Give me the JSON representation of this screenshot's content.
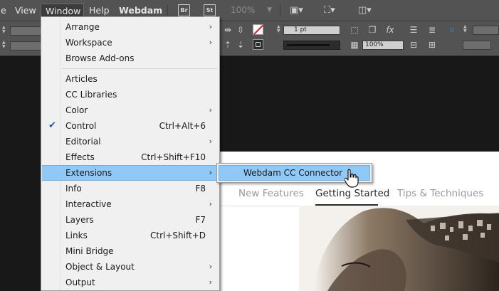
{
  "menubar": {
    "partial_item": "e",
    "items": [
      "View",
      "Window",
      "Help",
      "Webdam"
    ],
    "bridge_label": "Br",
    "stock_label": "St",
    "zoom": "100%"
  },
  "control": {
    "stroke_weight": "1 pt",
    "opacity": "100%"
  },
  "window_menu": {
    "items": [
      {
        "label": "Arrange",
        "submenu": true
      },
      {
        "label": "Workspace",
        "submenu": true
      },
      {
        "label": "Browse Add-ons"
      },
      {
        "label": "Articles"
      },
      {
        "label": "CC Libraries"
      },
      {
        "label": "Color",
        "submenu": true
      },
      {
        "label": "Control",
        "shortcut": "Ctrl+Alt+6",
        "checked": true
      },
      {
        "label": "Editorial",
        "submenu": true
      },
      {
        "label": "Effects",
        "shortcut": "Ctrl+Shift+F10"
      },
      {
        "label": "Extensions",
        "submenu": true,
        "highlighted": true
      },
      {
        "label": "Info",
        "shortcut": "F8"
      },
      {
        "label": "Interactive",
        "submenu": true
      },
      {
        "label": "Layers",
        "shortcut": "F7"
      },
      {
        "label": "Links",
        "shortcut": "Ctrl+Shift+D"
      },
      {
        "label": "Mini Bridge"
      },
      {
        "label": "Object & Layout",
        "submenu": true
      },
      {
        "label": "Output",
        "submenu": true
      }
    ]
  },
  "extensions_submenu": {
    "items": [
      "Webdam CC Connector"
    ]
  },
  "webpage": {
    "nav": [
      "New Features",
      "Getting Started",
      "Tips & Techniques"
    ],
    "current_index": 1
  },
  "colors": {
    "highlight": "#90c8f6",
    "menubar": "#535353",
    "pasteboard": "#181818"
  },
  "icons": {
    "check": "checkmark-icon",
    "submenu": "chevron-right-icon"
  }
}
